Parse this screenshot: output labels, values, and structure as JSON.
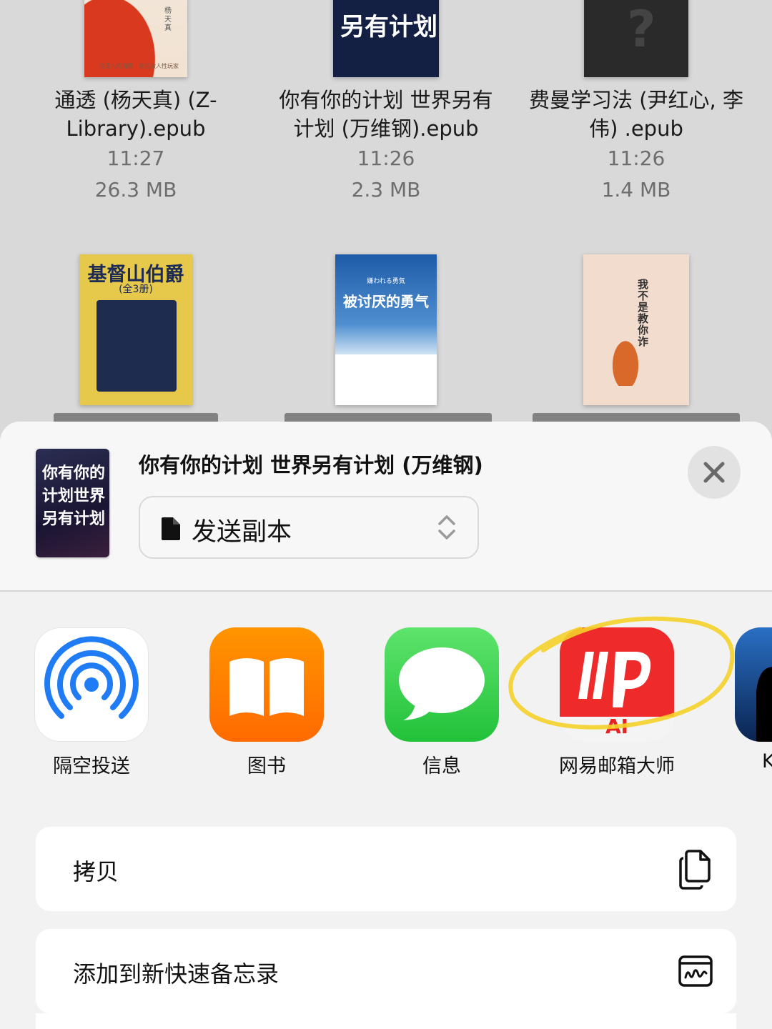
{
  "files": [
    {
      "name_line1": "通透 (杨天真) (Z-",
      "name_line2": "Library).epub",
      "time": "11:27",
      "size": "26.3 MB",
      "cover_author": "杨天真",
      "cover_text": "活成人间清醒　永远做人性玩家"
    },
    {
      "name_line1": "你有你的计划 世界另有",
      "name_line2": "计划 (万维钢).epub",
      "time": "11:26",
      "size": "2.3 MB",
      "cover_text": "另有计划"
    },
    {
      "name_line1": "费曼学习法 (尹红心, 李",
      "name_line2": "伟) .epub",
      "time": "11:26",
      "size": "1.4 MB"
    },
    {
      "cover_text": "基督山伯爵",
      "cover_sub": "(全3册)"
    },
    {
      "cover_text": "被讨厌的勇气",
      "cover_sub": "嫌われる勇気"
    },
    {
      "cover_text": "我不是教你诈"
    }
  ],
  "share": {
    "doc_title": "你有你的计划 世界另有计划 (万维钢)",
    "thumb_text": "你有你的计划世界另有计划",
    "mode": "发送副本",
    "apps": [
      {
        "label": "隔空投送",
        "icon": "airdrop-icon"
      },
      {
        "label": "图书",
        "icon": "books-icon"
      },
      {
        "label": "信息",
        "icon": "messages-icon"
      },
      {
        "label": "网易邮箱大师",
        "icon": "netease-mail-master-icon",
        "badge": "AI"
      },
      {
        "label": "K",
        "icon": "kindle-icon"
      }
    ],
    "actions": [
      {
        "label": "拷贝",
        "icon": "copy-icon"
      },
      {
        "label": "添加到新快速备忘录",
        "icon": "quick-note-icon"
      }
    ]
  },
  "colors": {
    "highlight": "#f5d12a",
    "airdrop": "#1f7cf5",
    "books": "#ff7a00",
    "messages": "#34c759",
    "mail": "#e62222"
  }
}
